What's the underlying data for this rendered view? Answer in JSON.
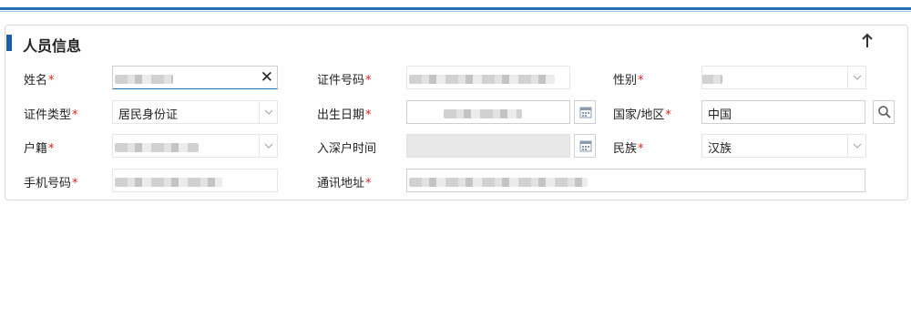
{
  "panel": {
    "title": "人员信息",
    "collapse_icon": "arrow-up-icon"
  },
  "fields": {
    "name": {
      "label": "姓名",
      "value": ""
    },
    "id_number": {
      "label": "证件号码",
      "value": ""
    },
    "gender": {
      "label": "性别",
      "value": ""
    },
    "id_type": {
      "label": "证件类型",
      "value": "居民身份证"
    },
    "birth_date": {
      "label": "出生日期",
      "value": ""
    },
    "country": {
      "label": "国家/地区",
      "value": "中国"
    },
    "hukou": {
      "label": "户籍",
      "value": ""
    },
    "sz_entry_time": {
      "label": "入深户时间",
      "value": ""
    },
    "ethnicity": {
      "label": "民族",
      "value": "汉族"
    },
    "mobile": {
      "label": "手机号码",
      "value": ""
    },
    "address": {
      "label": "通讯地址",
      "value": ""
    }
  },
  "required_mark": "*",
  "colors": {
    "accent": "#1f6fb2",
    "required": "#d22222",
    "marker": "#1d5fa6"
  }
}
